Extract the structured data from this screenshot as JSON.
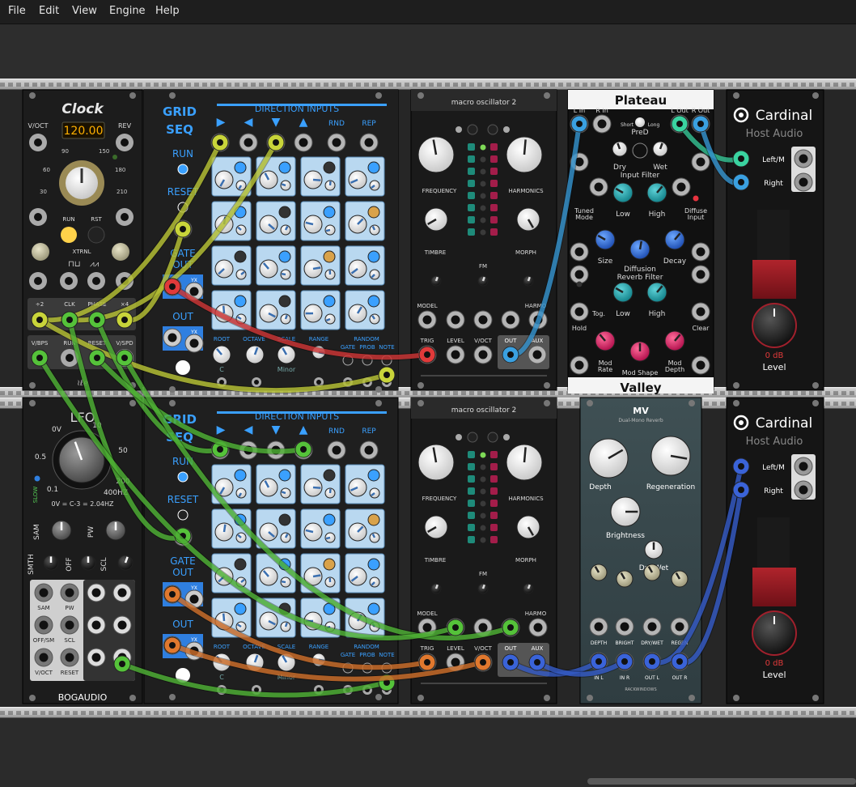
{
  "menu": [
    "File",
    "Edit",
    "View",
    "Engine",
    "Help"
  ],
  "clock": {
    "title": "Clock",
    "voct": "V/OCT",
    "rev": "REV",
    "bpm": "120.00",
    "ticks": [
      "30",
      "60",
      "90",
      "150",
      "180",
      "210"
    ],
    "run": "RUN",
    "rst": "RST",
    "xtrnl": "XTRNL",
    "jacks1": [
      "÷2",
      "CLK",
      "PHASE",
      "×4"
    ],
    "jacks2": [
      "V/BPS",
      "RUN",
      "RESET",
      "V/SPD"
    ]
  },
  "gridseq": {
    "title1": "GRID",
    "title2": "SEQ",
    "direction": "DIRECTION INPUTS",
    "rnd": "RND",
    "rep": "REP",
    "run": "RUN",
    "reset": "RESET",
    "gate1": "GATE",
    "gate2": "OUT",
    "out": "OUT",
    "yx": "YX",
    "bottom": [
      "ROOT",
      "OCTAVE",
      "SCALE",
      "RANGE"
    ],
    "random": "RANDOM",
    "random_sub": [
      "GATE",
      "PROB",
      "NOTE"
    ],
    "root_val": "C",
    "scale_val": "Minor"
  },
  "macro": {
    "title": "macro oscillator 2",
    "frequency": "FREQUENCY",
    "harmonics": "HARMONICS",
    "timbre": "TIMBRE",
    "fm": "FM",
    "morph": "MORPH",
    "model": "MODEL",
    "harmo": "HARMO",
    "trig": "TRIG",
    "level": "LEVEL",
    "voct": "V/OCT",
    "out": "OUT",
    "aux": "AUX"
  },
  "plateau": {
    "title": "Plateau",
    "footer": "Valley",
    "lin": "L In",
    "rin": "R In",
    "short": "Short",
    "long": "Long",
    "pred": "PreD",
    "lout": "L Out",
    "rout": "R Out",
    "dry": "Dry",
    "wet": "Wet",
    "input_filter": "Input Filter",
    "tuned": "Tuned",
    "mode": "Mode",
    "low": "Low",
    "high": "High",
    "diffuse": "Diffuse",
    "input": "Input",
    "size": "Size",
    "smi": "Sml",
    "lrg": "Lrg",
    "decay": "Decay",
    "shrt": "Shrt",
    "lng": "Lng",
    "diffusion": "Diffusion",
    "reverb_filter": "Reverb Filter",
    "tog": "Tog.",
    "hold": "Hold",
    "clear": "Clear",
    "slow": "Slow",
    "fast": "Fast",
    "mod_rate1": "Mod",
    "mod_rate2": "Rate",
    "mod_shape": "Mod Shape",
    "mod_depth1": "Mod",
    "mod_depth2": "Depth",
    "zero": "0",
    "ten": "10"
  },
  "cardinal": {
    "brand": "Cardinal",
    "sub": "Host Audio",
    "left": "Left/M",
    "right": "Right",
    "db": "0 dB",
    "level": "Level"
  },
  "lfo": {
    "title": "LFO",
    "ov": "0V",
    "ten": "10",
    "fifty": "50",
    "two_hundred": "200",
    "fourhz": "400HZ",
    "pointfive": "0.5",
    "pointone": "0.1",
    "slow": "SLOW",
    "formula": "0V = C-3 = 2.04HZ",
    "sam": "SAM",
    "pw": "PW",
    "smth": "SMTH",
    "off": "OFF",
    "scl": "SCL",
    "j1": [
      "SAM",
      "PW"
    ],
    "j2": [
      "OFF/SM",
      "SCL"
    ],
    "j3": [
      "V/OCT",
      "RESET"
    ],
    "footer": "BOGAUDIO"
  },
  "mv": {
    "title": "MV",
    "sub": "Dual-Mono Reverb",
    "depth": "Depth",
    "regen": "Regeneration",
    "bright": "Brightness",
    "drywet": "Dry/Wet",
    "jack_labels": [
      "DEPTH",
      "BRIGHT",
      "DRY/WET",
      "REGEN"
    ],
    "io_labels": [
      "IN L",
      "IN R",
      "OUT L",
      "OUT R"
    ],
    "footer": "RACKWINDOWS"
  },
  "colors": {
    "cable_yellow": "#c8d43a",
    "cable_green": "#55c23a",
    "cable_red": "#e03a3a",
    "cable_orange": "#e0782e",
    "cable_blue": "#3a63d8",
    "cable_lightblue": "#3aa0e0",
    "cable_teal": "#3ad3a0",
    "led_amber": "#ffb000"
  }
}
